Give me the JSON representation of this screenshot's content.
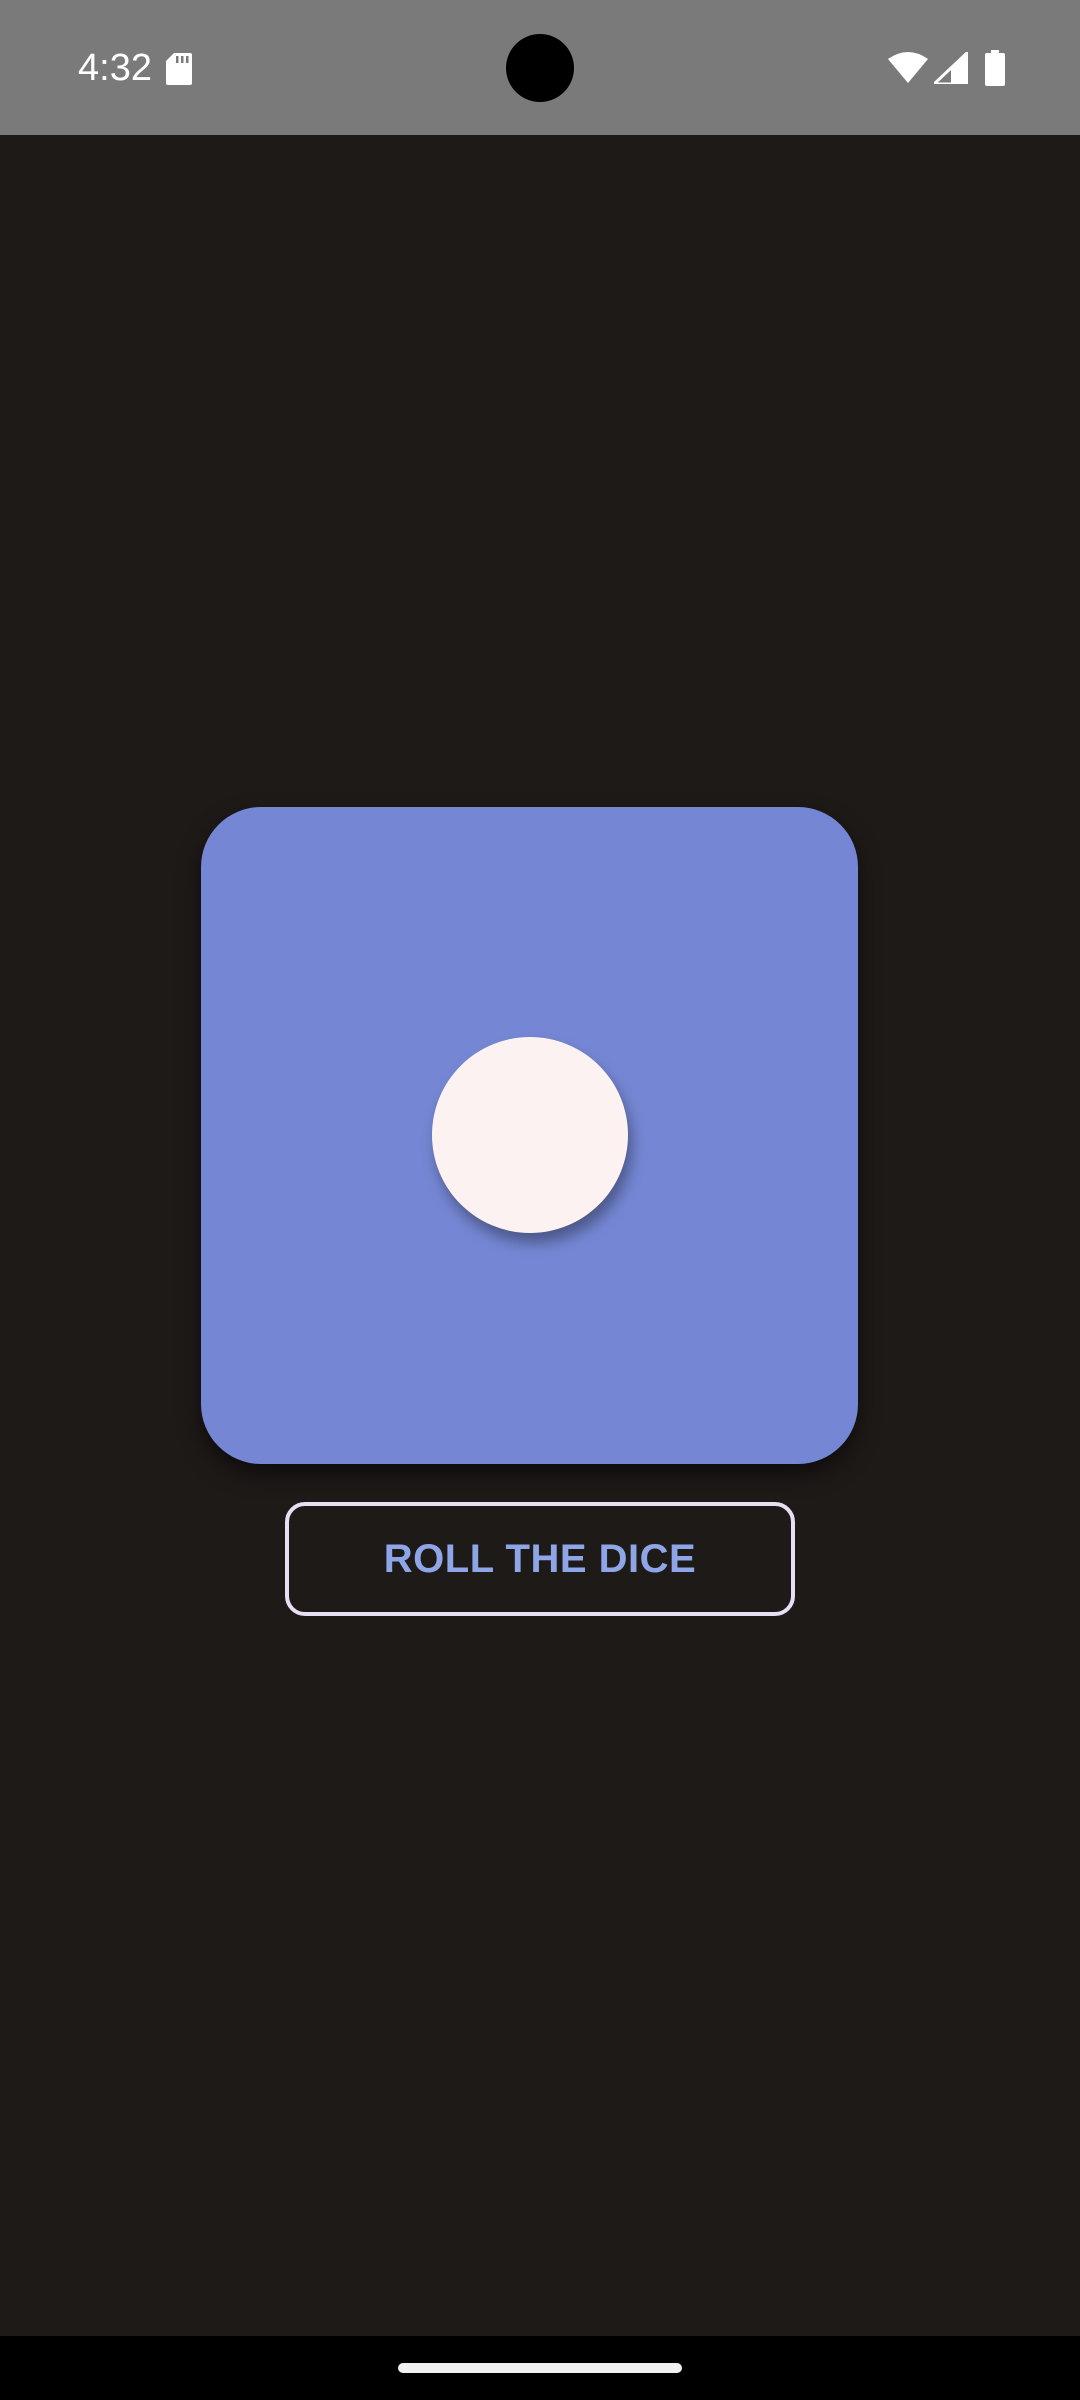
{
  "status_bar": {
    "time": "4:32",
    "icons": [
      "sd-card-icon",
      "wifi-icon",
      "signal-icon",
      "battery-icon"
    ],
    "background_color": "#7a7a7a"
  },
  "dice": {
    "face_value": 1,
    "card_color": "#7587d4",
    "pip_color": "#fdf2f2"
  },
  "roll_button": {
    "label": "ROLL THE DICE",
    "text_color": "#8ea6e8",
    "border_color": "#e8dff5"
  },
  "theme": {
    "background": "#1e1a18"
  },
  "nav_bar": {
    "icons": [
      "home-indicator"
    ]
  }
}
